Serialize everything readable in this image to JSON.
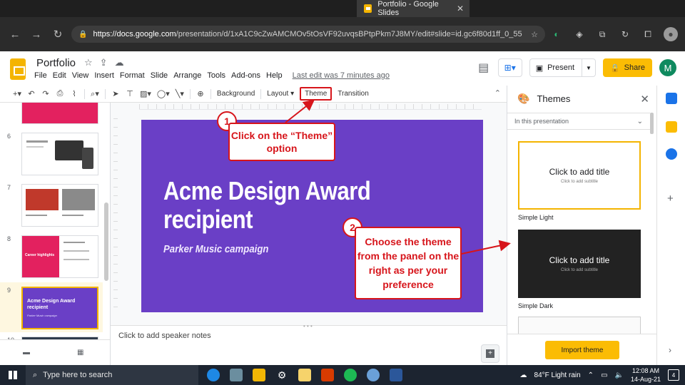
{
  "browser": {
    "tab_title": "Portfolio - Google Slides",
    "url_host": "https://docs.google.com",
    "url_path": "/presentation/d/1xA1C9cZwAMCMOv5tOsVF92uvqsBPtpPkm7J8MY/edit#slide=id.gc6f80d1ff_0_55"
  },
  "app": {
    "doc_title": "Portfolio",
    "menu": [
      "File",
      "Edit",
      "View",
      "Insert",
      "Format",
      "Slide",
      "Arrange",
      "Tools",
      "Add-ons",
      "Help"
    ],
    "last_edit": "Last edit was 7 minutes ago",
    "present_label": "Present",
    "share_label": "Share",
    "user_initial": "M"
  },
  "toolbar": {
    "background_label": "Background",
    "layout_label": "Layout",
    "theme_label": "Theme",
    "transition_label": "Transition"
  },
  "filmstrip": {
    "slides": [
      {
        "num": "6"
      },
      {
        "num": "7"
      },
      {
        "num": "8",
        "title": "Career highlights"
      },
      {
        "num": "9",
        "title": "Acme Design Award recipient",
        "subtitle": "Parker Music campaign"
      },
      {
        "num": "10"
      }
    ]
  },
  "slide": {
    "title": "Acme Design Award recipient",
    "subtitle": "Parker Music campaign",
    "background_color": "#6a3fc6"
  },
  "notes": {
    "placeholder": "Click to add speaker notes"
  },
  "themes_panel": {
    "title": "Themes",
    "section": "In this presentation",
    "themes": [
      {
        "name": "Simple Light",
        "preview_title": "Click to add title",
        "preview_subtitle": "Click to add subtitle"
      },
      {
        "name": "Simple Dark",
        "preview_title": "Click to add title",
        "preview_subtitle": "Click to add subtitle"
      }
    ],
    "import_label": "Import theme"
  },
  "annotations": {
    "step1": {
      "number": "1",
      "text": "Click on the “Theme” option"
    },
    "step2": {
      "number": "2",
      "text": "Choose the theme from the panel on the right as per your preference"
    },
    "color": "#d7151b"
  },
  "taskbar": {
    "search_placeholder": "Type here to search",
    "weather": "84°F  Light rain",
    "time": "12:08 AM",
    "date": "14-Aug-21",
    "notif_count": "4"
  }
}
